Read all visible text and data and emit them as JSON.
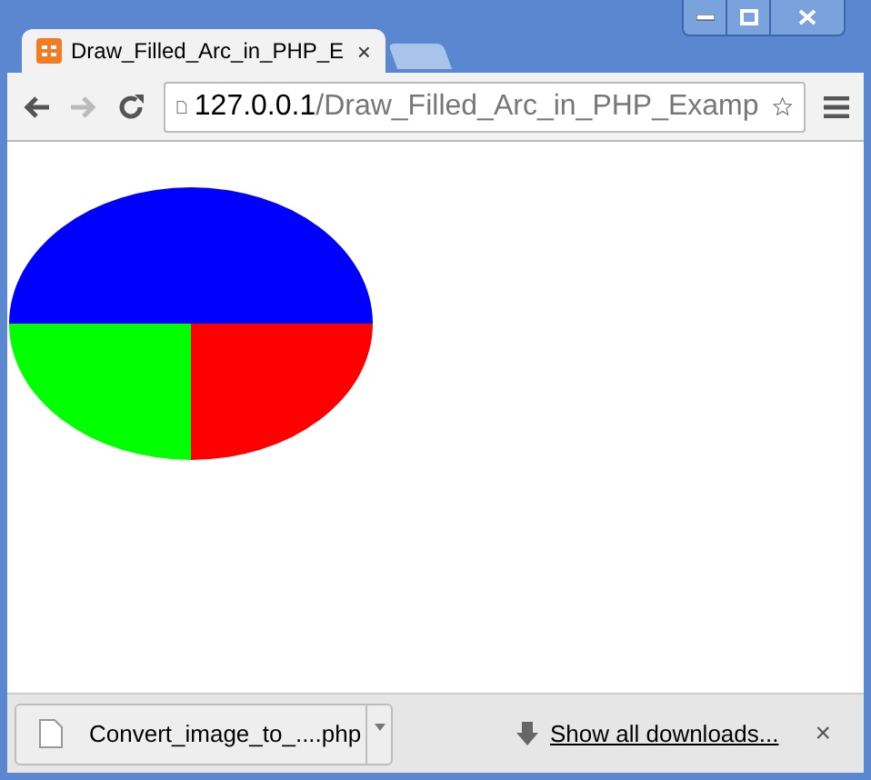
{
  "tabs": [
    {
      "title": "Draw_Filled_Arc_in_PHP_E",
      "close": "×",
      "selected": true
    }
  ],
  "address_bar": {
    "host": "127.0.0.1",
    "path": "/Draw_Filled_Arc_in_PHP_Examp"
  },
  "downloads_bar": {
    "file": "Convert_image_to_....php",
    "show_all": "Show all downloads...",
    "close": "×"
  }
}
